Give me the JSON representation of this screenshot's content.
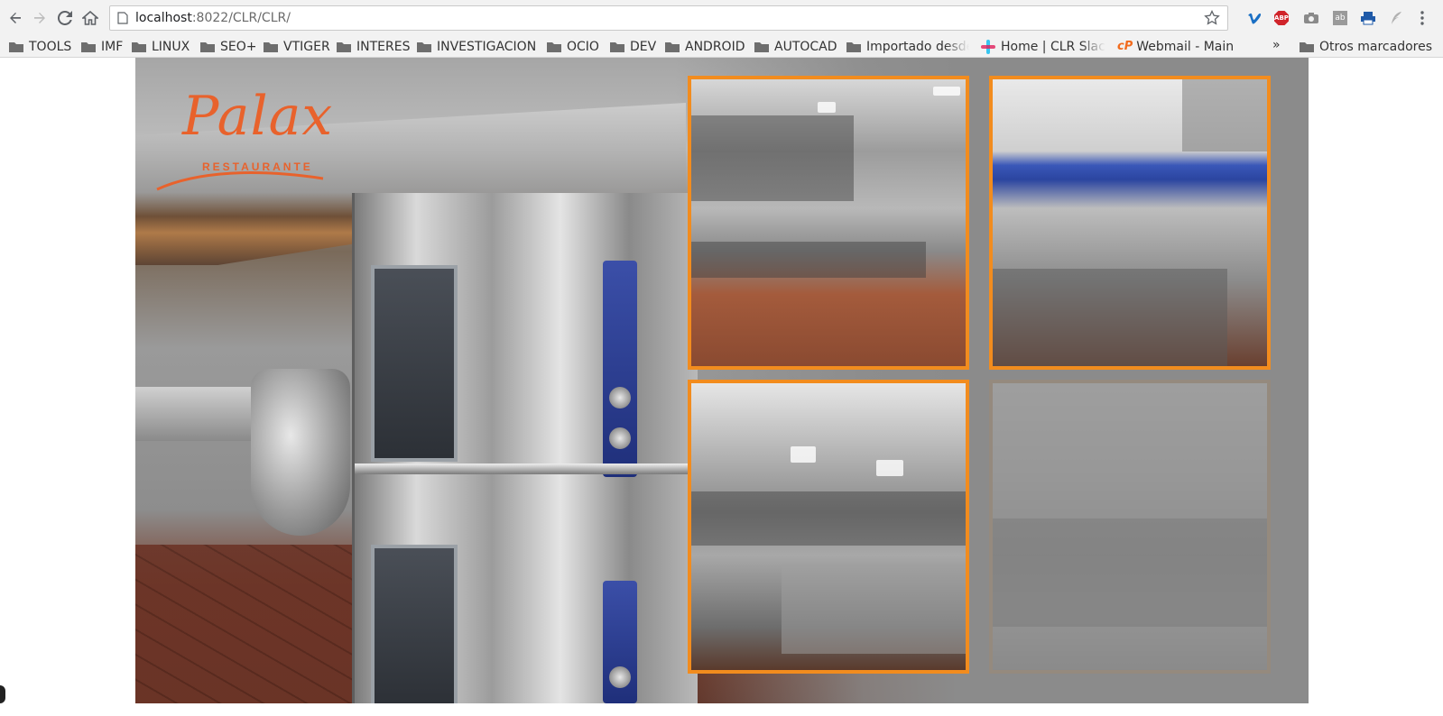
{
  "browser": {
    "url_host": "localhost",
    "url_path": ":8022/CLR/CLR/",
    "bookmarks": [
      {
        "label": "TOOLS"
      },
      {
        "label": "IMF"
      },
      {
        "label": "LINUX"
      },
      {
        "label": "SEO+"
      },
      {
        "label": "VTIGER"
      },
      {
        "label": "INTERES"
      },
      {
        "label": "INVESTIGACION"
      },
      {
        "label": "OCIO"
      },
      {
        "label": "DEV"
      },
      {
        "label": "ANDROID"
      },
      {
        "label": "AUTOCAD"
      },
      {
        "label": "Importado desde"
      },
      {
        "label": "Home | CLR Slac"
      },
      {
        "label": "Webmail - Main"
      }
    ],
    "more_label": "»",
    "other_bookmarks": "Otros marcadores",
    "extensions": [
      "vimeo-icon",
      "adblock-plus-icon",
      "camera-icon",
      "ab-icon",
      "print-icon",
      "feather-icon",
      "menu-icon"
    ],
    "adblock_label": "ABP",
    "ab_label": "ab"
  },
  "page": {
    "logo_word": "Palax",
    "logo_sub": "RESTAURANTE",
    "thumbnails": [
      {
        "name": "kitchen-photo-hood-line",
        "state": "active"
      },
      {
        "name": "kitchen-photo-sink",
        "state": "active"
      },
      {
        "name": "kitchen-photo-prep-line",
        "state": "active"
      },
      {
        "name": "kitchen-photo-counter",
        "state": "dimmed"
      }
    ]
  },
  "colors": {
    "accent_orange": "#f28c1e",
    "logo_orange": "#e8622c",
    "stage_gray": "#8b8b8b"
  }
}
